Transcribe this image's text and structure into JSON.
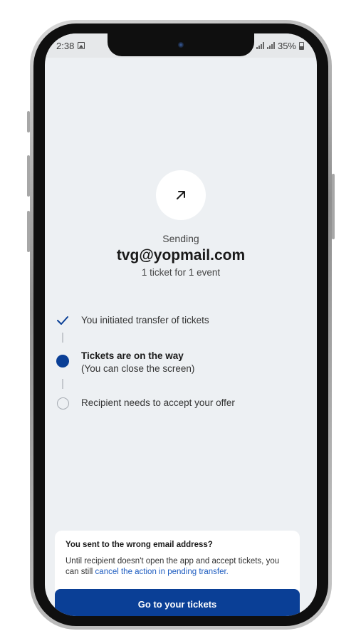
{
  "status_bar": {
    "time": "2:38",
    "battery": "35%"
  },
  "header": {
    "icon": "arrow-up-right-icon",
    "label": "Sending",
    "email": "tvg@yopmail.com",
    "summary": "1 ticket for 1 event"
  },
  "steps": [
    {
      "title": "You initiated transfer of tickets",
      "subtitle": "",
      "state": "done"
    },
    {
      "title": "Tickets are on the way",
      "subtitle": "(You can close the screen)",
      "state": "current"
    },
    {
      "title": "Recipient needs to accept your offer",
      "subtitle": "",
      "state": "pending"
    }
  ],
  "info": {
    "title": "You sent to the wrong email address?",
    "body": "Until recipient doesn't open the app and accept tickets, you can still ",
    "link": "cancel the action in pending transfer.",
    "link_color": "#1d5cc0"
  },
  "primary_button": {
    "label": "Go to your tickets",
    "color": "#0a3f96"
  },
  "colors": {
    "accent": "#0a3f96",
    "background": "#edf0f3"
  }
}
